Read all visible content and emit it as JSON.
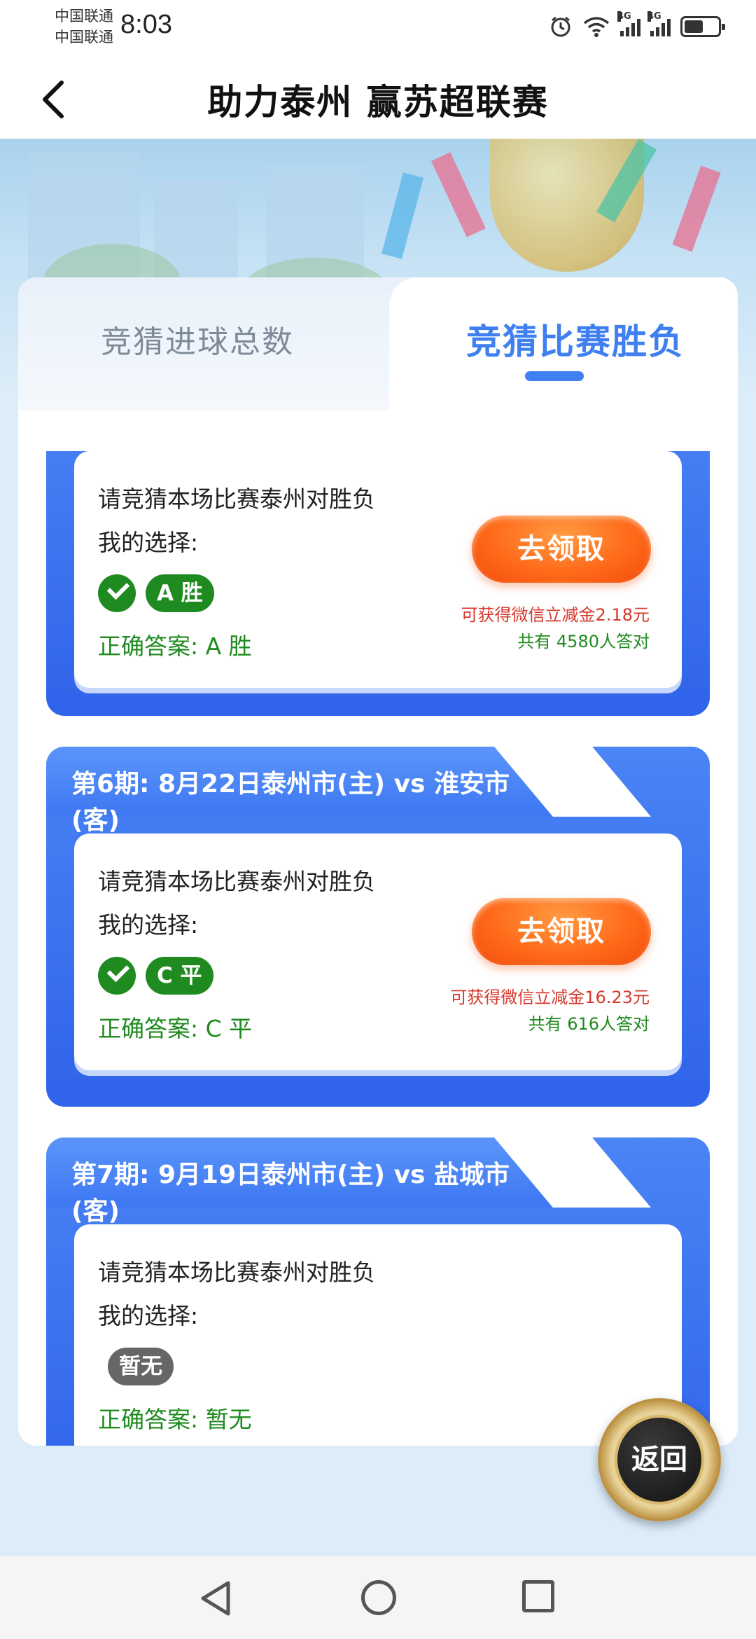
{
  "status_bar": {
    "carrier_1": "中国联通",
    "carrier_2": "中国联通",
    "time": "8:03",
    "network_1": "4G",
    "network_2": "4G"
  },
  "header": {
    "title": "助力泰州 赢苏超联赛"
  },
  "tabs": [
    {
      "label": "竞猜进球总数",
      "active": false
    },
    {
      "label": "竞猜比赛胜负",
      "active": true
    }
  ],
  "rounds": [
    {
      "title": "",
      "question": "请竞猜本场比赛泰州对胜负",
      "my_choice_label": "我的选择:",
      "choice": "A 胜",
      "answer": "正确答案:  A 胜",
      "button_label": "去领取",
      "reward": "可获得微信立减金2.18元",
      "count": "共有 4580人答对"
    },
    {
      "title": "第6期: 8月22日泰州市(主) vs 淮安市(客)",
      "question": "请竞猜本场比赛泰州对胜负",
      "my_choice_label": "我的选择:",
      "choice": "C 平",
      "answer": "正确答案:  C 平",
      "button_label": "去领取",
      "reward": "可获得微信立减金16.23元",
      "count": "共有 616人答对"
    },
    {
      "title": "第7期: 9月19日泰州市(主) vs 盐城市(客)",
      "question": "请竞猜本场比赛泰州对胜负",
      "my_choice_label": "我的选择:",
      "choice": "暂无",
      "answer": "正确答案:  暂无"
    }
  ],
  "return_button": "返回",
  "colors": {
    "accent_blue": "#3f7ff0",
    "correct_green": "#1f8a1f",
    "reward_red": "#d6372a",
    "button_orange": "#ff6a1a"
  }
}
